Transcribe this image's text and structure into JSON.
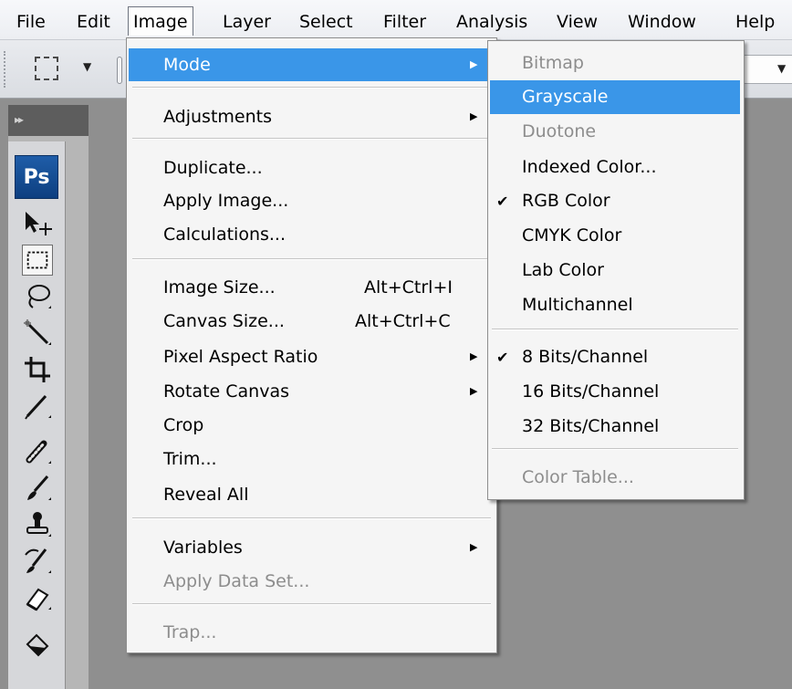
{
  "menubar": {
    "items": [
      "File",
      "Edit",
      "Image",
      "Layer",
      "Select",
      "Filter",
      "Analysis",
      "View",
      "Window",
      "Help"
    ],
    "open_item": "Image"
  },
  "toolbox": {
    "logo": "Ps",
    "tools": [
      "move-tool",
      "marquee-tool",
      "lasso-tool",
      "magic-wand-tool",
      "crop-tool",
      "slice-tool",
      "healing-brush-tool",
      "brush-tool",
      "clone-stamp-tool",
      "history-brush-tool",
      "eraser-tool",
      "paint-bucket-tool"
    ]
  },
  "image_menu": {
    "mode": "Mode",
    "adjustments": "Adjustments",
    "duplicate": "Duplicate...",
    "apply_image": "Apply Image...",
    "calculations": "Calculations...",
    "image_size": "Image Size...",
    "image_size_shortcut": "Alt+Ctrl+I",
    "canvas_size": "Canvas Size...",
    "canvas_size_shortcut": "Alt+Ctrl+C",
    "pixel_aspect_ratio": "Pixel Aspect Ratio",
    "rotate_canvas": "Rotate Canvas",
    "crop": "Crop",
    "trim": "Trim...",
    "reveal_all": "Reveal All",
    "variables": "Variables",
    "apply_data_set": "Apply Data Set...",
    "trap": "Trap..."
  },
  "mode_menu": {
    "bitmap": "Bitmap",
    "grayscale": "Grayscale",
    "duotone": "Duotone",
    "indexed_color": "Indexed Color...",
    "rgb_color": "RGB Color",
    "cmyk_color": "CMYK Color",
    "lab_color": "Lab Color",
    "multichannel": "Multichannel",
    "bits_8": "8 Bits/Channel",
    "bits_16": "16 Bits/Channel",
    "bits_32": "32 Bits/Channel",
    "color_table": "Color Table...",
    "checked": [
      "RGB Color",
      "8 Bits/Channel"
    ],
    "highlighted": "Grayscale"
  },
  "colors": {
    "highlight": "#3a96e8",
    "disabled_text": "#8d8d8d",
    "workspace": "#8f8f8f"
  }
}
